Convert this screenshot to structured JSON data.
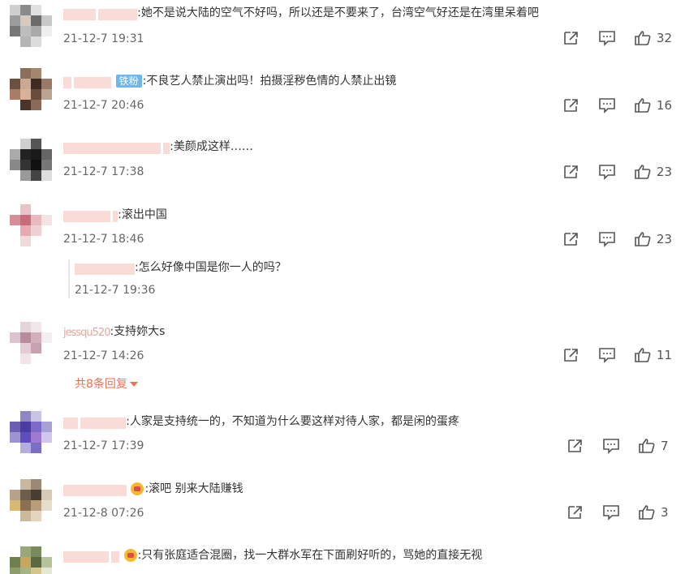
{
  "comments": [
    {
      "text": ":她不是说大陆的空气不好吗，所以还是不要来了，台湾空气好还是在湾里呆着吧",
      "time": "21-12-7 19:31",
      "likes": "32"
    },
    {
      "badge": "铁粉",
      "text": ":不良艺人禁止演出吗！拍摄淫秽色情的人禁止出镜",
      "time": "21-12-7 20:46",
      "likes": "16"
    },
    {
      "text": ":美颜成这样……",
      "time": "21-12-7 17:38",
      "likes": "23"
    },
    {
      "text": ":滚出中国",
      "time": "21-12-7 18:46",
      "likes": "23",
      "reply": {
        "text": ":怎么好像中国是你一人的吗？",
        "time": "21-12-7 19:36"
      }
    },
    {
      "name": "jessqu520",
      "text": ":支持妳大s",
      "time": "21-12-7 14:26",
      "likes": "11",
      "more": "共8条回复"
    },
    {
      "text": ":人家是支持统一的，不知道为什么要这样对待人家，都是闲的蛋疼",
      "time": "21-12-7 17:39",
      "likes": "7"
    },
    {
      "text": ":滚吧 别来大陆赚钱",
      "time": "21-12-8 07:26",
      "likes": "3"
    },
    {
      "text": ":只有张庭适合混圈，找一大群水军在下面刷好听的，骂她的直接无视"
    }
  ]
}
